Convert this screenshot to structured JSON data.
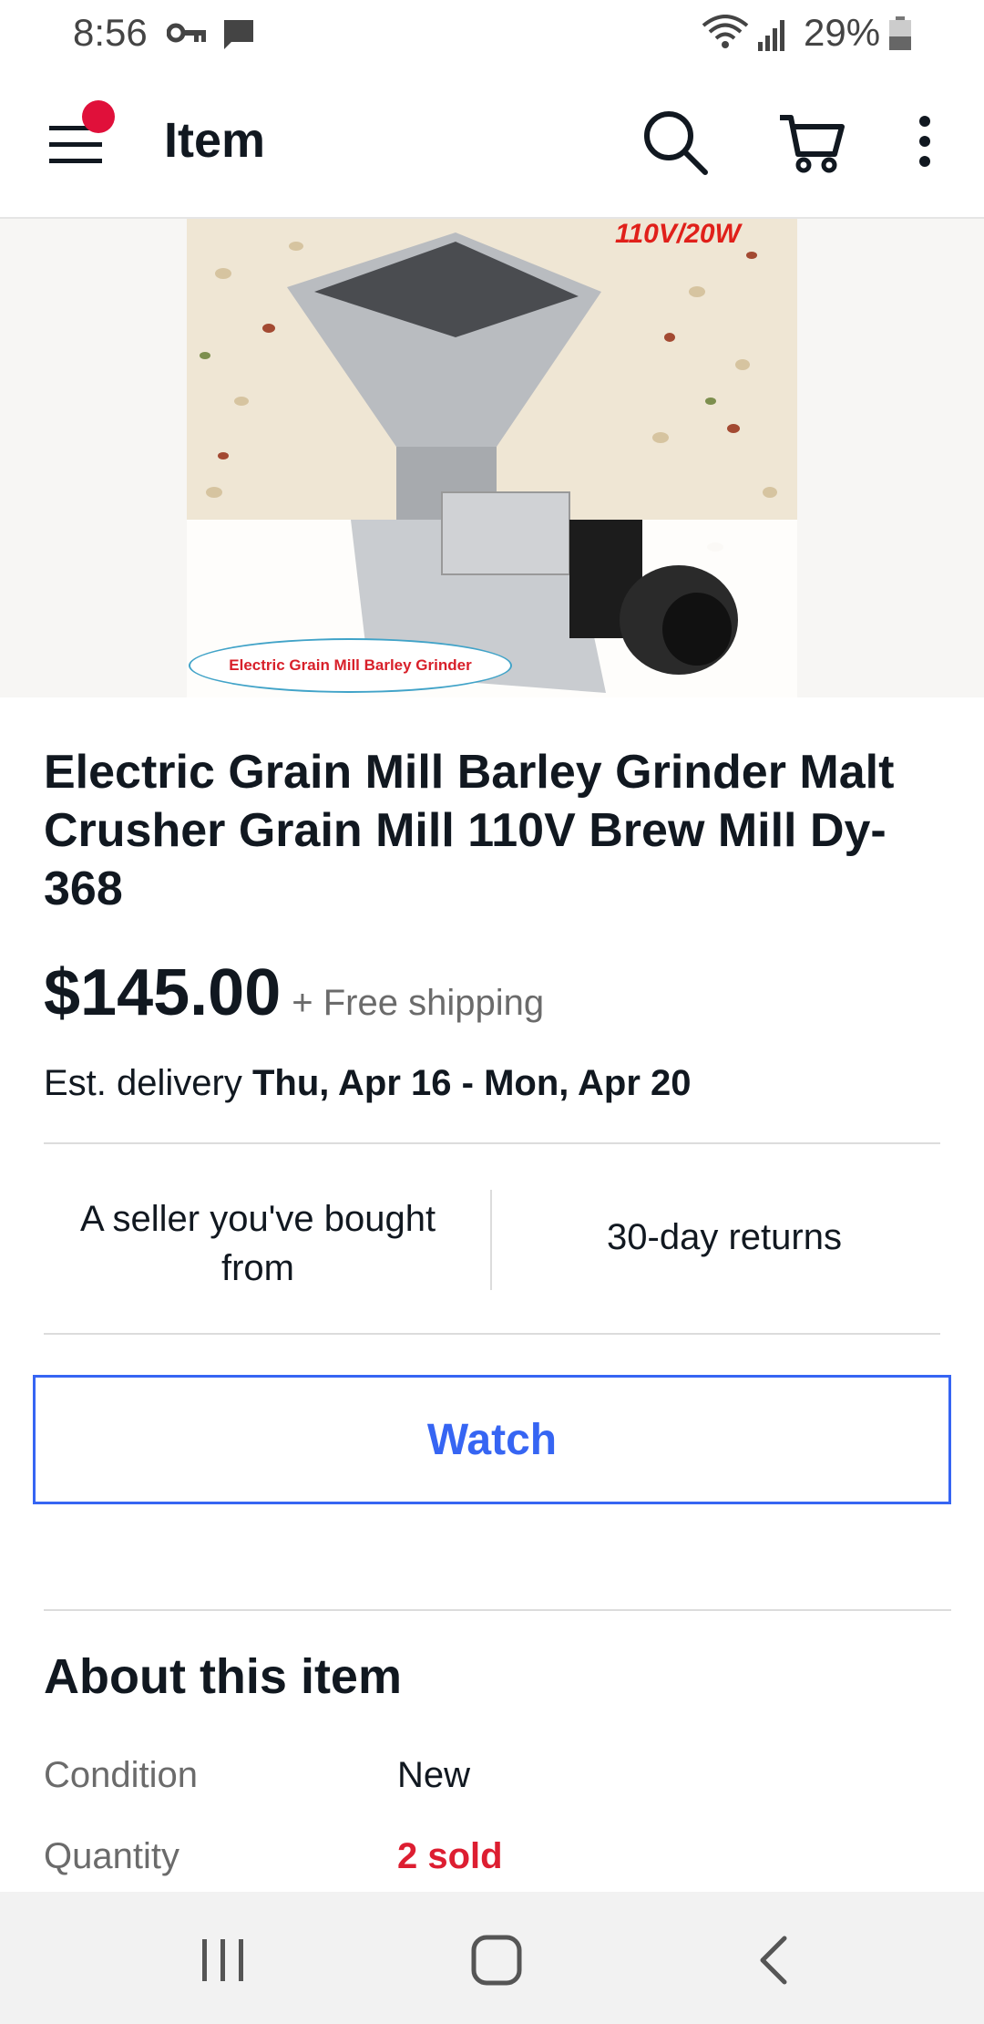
{
  "status_bar": {
    "time": "8:56",
    "battery": "29%"
  },
  "header": {
    "title": "Item"
  },
  "hero": {
    "badge": "110V/20W",
    "caption": "Electric Grain Mill Barley Grinder"
  },
  "item": {
    "title": "Electric Grain Mill Barley Grinder Malt Crusher Grain Mill 110V Brew Mill Dy-368",
    "price": "$145.00",
    "shipping": "+ Free shipping",
    "delivery_prefix": "Est. delivery",
    "delivery_dates": "Thu, Apr 16 - Mon, Apr 20"
  },
  "trust": {
    "seller": "A seller you've bought from",
    "returns": "30-day returns"
  },
  "actions": {
    "watch_label": "Watch"
  },
  "about": {
    "title": "About this item",
    "rows": [
      {
        "label": "Condition",
        "value": "New"
      },
      {
        "label": "Quantity",
        "value": "2 sold"
      }
    ]
  },
  "colors": {
    "accent_blue": "#3665f3",
    "sold_red": "#dd1e31",
    "notification_red": "#e0103a"
  }
}
